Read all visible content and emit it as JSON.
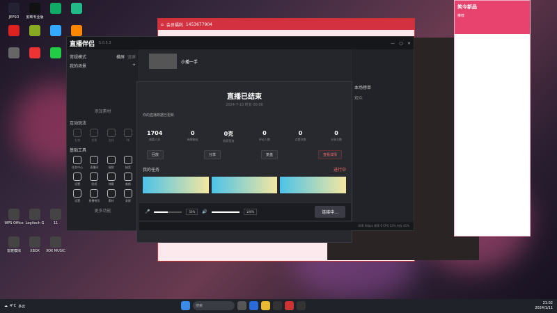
{
  "desktop": {
    "icons": [
      {
        "label": "JEPSO",
        "color": "#223"
      },
      {
        "label": "剪映专业版",
        "color": "#111"
      },
      {
        "label": "",
        "color": "#1a6"
      },
      {
        "label": "",
        "color": "#2b8"
      },
      {
        "label": "",
        "color": "#d22"
      },
      {
        "label": "",
        "color": "#8a2"
      },
      {
        "label": "",
        "color": "#3af"
      },
      {
        "label": "",
        "color": "#f80"
      },
      {
        "label": "",
        "color": "#666"
      },
      {
        "label": "",
        "color": "#e33"
      },
      {
        "label": "",
        "color": "#2c4"
      },
      {
        "label": "",
        "color": "#b36"
      }
    ],
    "bottom_icons": [
      "WPS Office",
      "Logitech G",
      "11",
      "雷霆模拟",
      "XBOX",
      "XOX MUSIC"
    ]
  },
  "red_window": {
    "title": "会员福利",
    "counter": "1453677904"
  },
  "pink_window": {
    "title": "笑今新品",
    "tab": "推荐"
  },
  "app": {
    "name": "直播伴侣",
    "version": "5.0.5.3",
    "user_tab": "小播一手",
    "sidebar": {
      "mode_label": "常规模式",
      "tabs": [
        "横屏",
        "竖屏"
      ],
      "my_scene": "我的场景",
      "add_scene": "添加素材",
      "section_interact": "互动玩法",
      "section_basic": "基础工具",
      "more": "更多功能",
      "interact_tools": [
        "礼物",
        "投票",
        "连线",
        "PK"
      ],
      "basic_tools": [
        "任务中心",
        "直播间",
        "福袋",
        "抽奖",
        "设置",
        "贴纸",
        "弹幕",
        "美颜",
        "设置",
        "直播带货",
        "素材",
        "录屏"
      ]
    },
    "modal": {
      "title": "直播已结束",
      "subtitle": "2024-7-10 时长 00:00",
      "hint": "你的直播数据已更新",
      "stats": [
        {
          "value": "1704",
          "label": "观看人次"
        },
        {
          "value": "0",
          "label": "新增粉丝"
        },
        {
          "value": "0克",
          "label": "收获音浪"
        },
        {
          "value": "0",
          "label": "评论人数"
        },
        {
          "value": "0",
          "label": "点赞次数"
        },
        {
          "value": "0",
          "label": "分享次数"
        }
      ],
      "actions": [
        "回放",
        "分享",
        "复盘",
        "查看详情"
      ],
      "task_title": "我的任务",
      "task_status": "进行中"
    },
    "control": {
      "mic_label": "麦克风",
      "mic_pct": "50%",
      "mic_level": 50,
      "speaker_label": "扬声器",
      "speaker_pct": "100%",
      "speaker_level": 100,
      "go_live": "连接中..."
    },
    "right": {
      "title": "本场榜单",
      "label": "观众"
    },
    "statusbar": "码率 0kbps   帧率 0   CPU 13%   内存 41%"
  },
  "taskbar": {
    "weather": "4°C",
    "weather_desc": "多云",
    "search_placeholder": "搜索",
    "time": "21:02",
    "date": "2024/1/11"
  }
}
